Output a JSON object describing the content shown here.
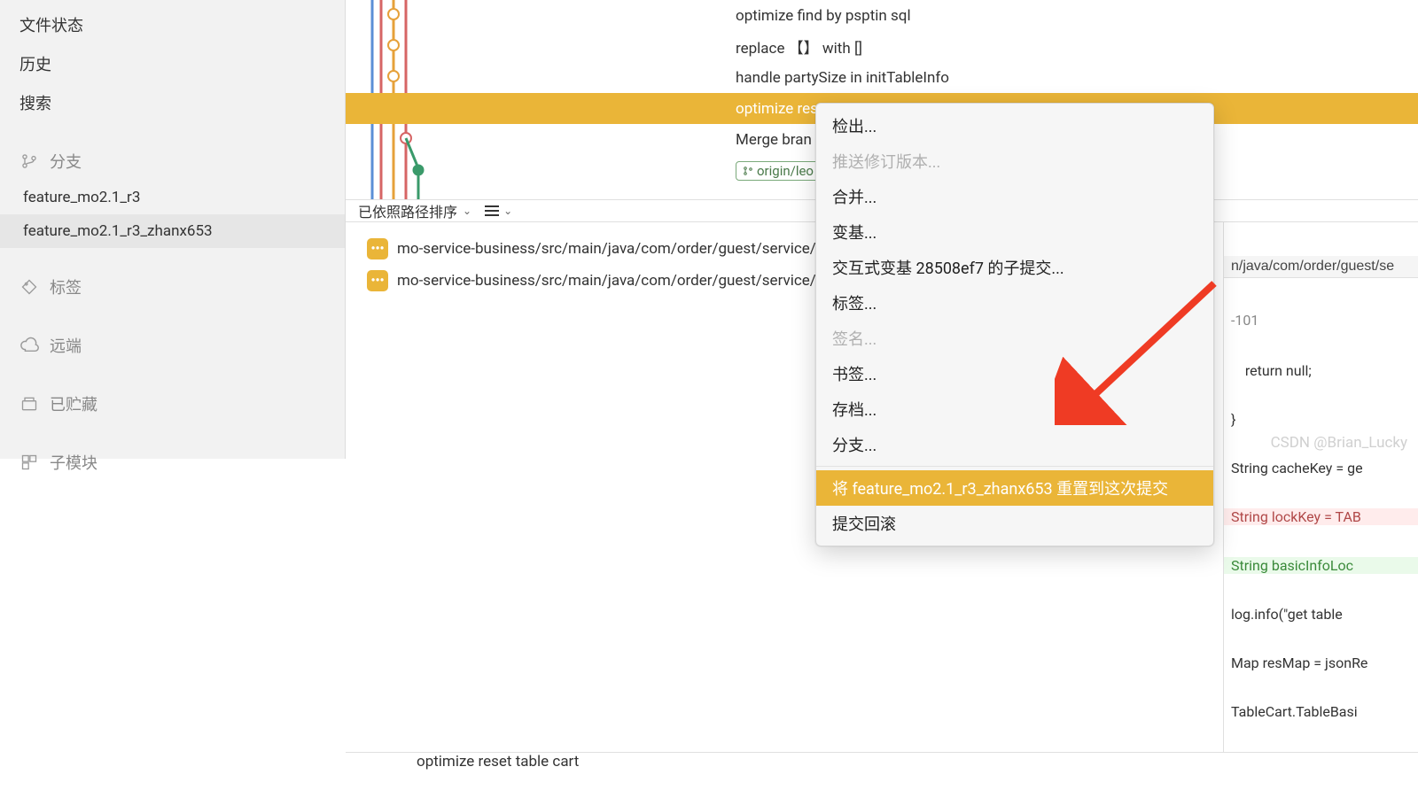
{
  "sidebar": {
    "items": [
      {
        "label": "文件状态",
        "icon": null
      },
      {
        "label": "历史",
        "icon": null
      },
      {
        "label": "搜索",
        "icon": null
      }
    ],
    "branch_header": "分支",
    "branches": [
      {
        "label": "feature_mo2.1_r3",
        "selected": false
      },
      {
        "label": "feature_mo2.1_r3_zhanx653",
        "selected": true
      }
    ],
    "sections": [
      {
        "label": "标签",
        "icon": "tag-icon"
      },
      {
        "label": "远端",
        "icon": "cloud-icon"
      },
      {
        "label": "已贮藏",
        "icon": "stash-icon"
      },
      {
        "label": "子模块",
        "icon": "submodule-icon"
      }
    ]
  },
  "commits": [
    {
      "msg": "optimize find by psptin sql"
    },
    {
      "msg": "replace 【】 with []"
    },
    {
      "msg": "handle partySize in initTableInfo"
    },
    {
      "msg": "optimize res",
      "hl": true
    },
    {
      "msg": "Merge bran"
    },
    {
      "msg": "origin/leo",
      "tag": true,
      "after": "Merge bran"
    }
  ],
  "toolbar": {
    "sort": "已依照路径排序"
  },
  "files": [
    {
      "path": "mo-service-business/src/main/java/com/order/guest/service/cache/T"
    },
    {
      "path": "mo-service-business/src/main/java/com/order/guest/service/imp/Sho"
    }
  ],
  "commit_msg": "optimize reset table cart",
  "diff": {
    "header": "n/java/com/order/guest/se",
    "hunk": "-101",
    "lines": [
      {
        "t": "    return null;",
        "c": ""
      },
      {
        "t": "}",
        "c": ""
      },
      {
        "t": "String cacheKey = ge",
        "c": ""
      },
      {
        "t": "String lockKey = TAB",
        "c": "del"
      },
      {
        "t": "String basicInfoLoc",
        "c": "add"
      },
      {
        "t": "log.info(\"get table",
        "c": ""
      },
      {
        "t": "Map resMap = jsonRe",
        "c": ""
      },
      {
        "t": "TableCart.TableBasi",
        "c": ""
      }
    ]
  },
  "menu": [
    {
      "label": "检出...",
      "type": "item"
    },
    {
      "label": "推送修订版本...",
      "type": "dis"
    },
    {
      "label": "合并...",
      "type": "item"
    },
    {
      "label": "变基...",
      "type": "item"
    },
    {
      "label": "交互式变基 28508ef7 的子提交...",
      "type": "item"
    },
    {
      "label": "标签...",
      "type": "item"
    },
    {
      "label": "签名...",
      "type": "dis"
    },
    {
      "label": "书签...",
      "type": "item"
    },
    {
      "label": "存档...",
      "type": "item"
    },
    {
      "label": "分支...",
      "type": "item"
    },
    {
      "type": "sep"
    },
    {
      "label": "将 feature_mo2.1_r3_zhanx653 重置到这次提交",
      "type": "sel"
    },
    {
      "label": "提交回滚",
      "type": "item"
    }
  ],
  "watermark": "CSDN @Brian_Lucky"
}
